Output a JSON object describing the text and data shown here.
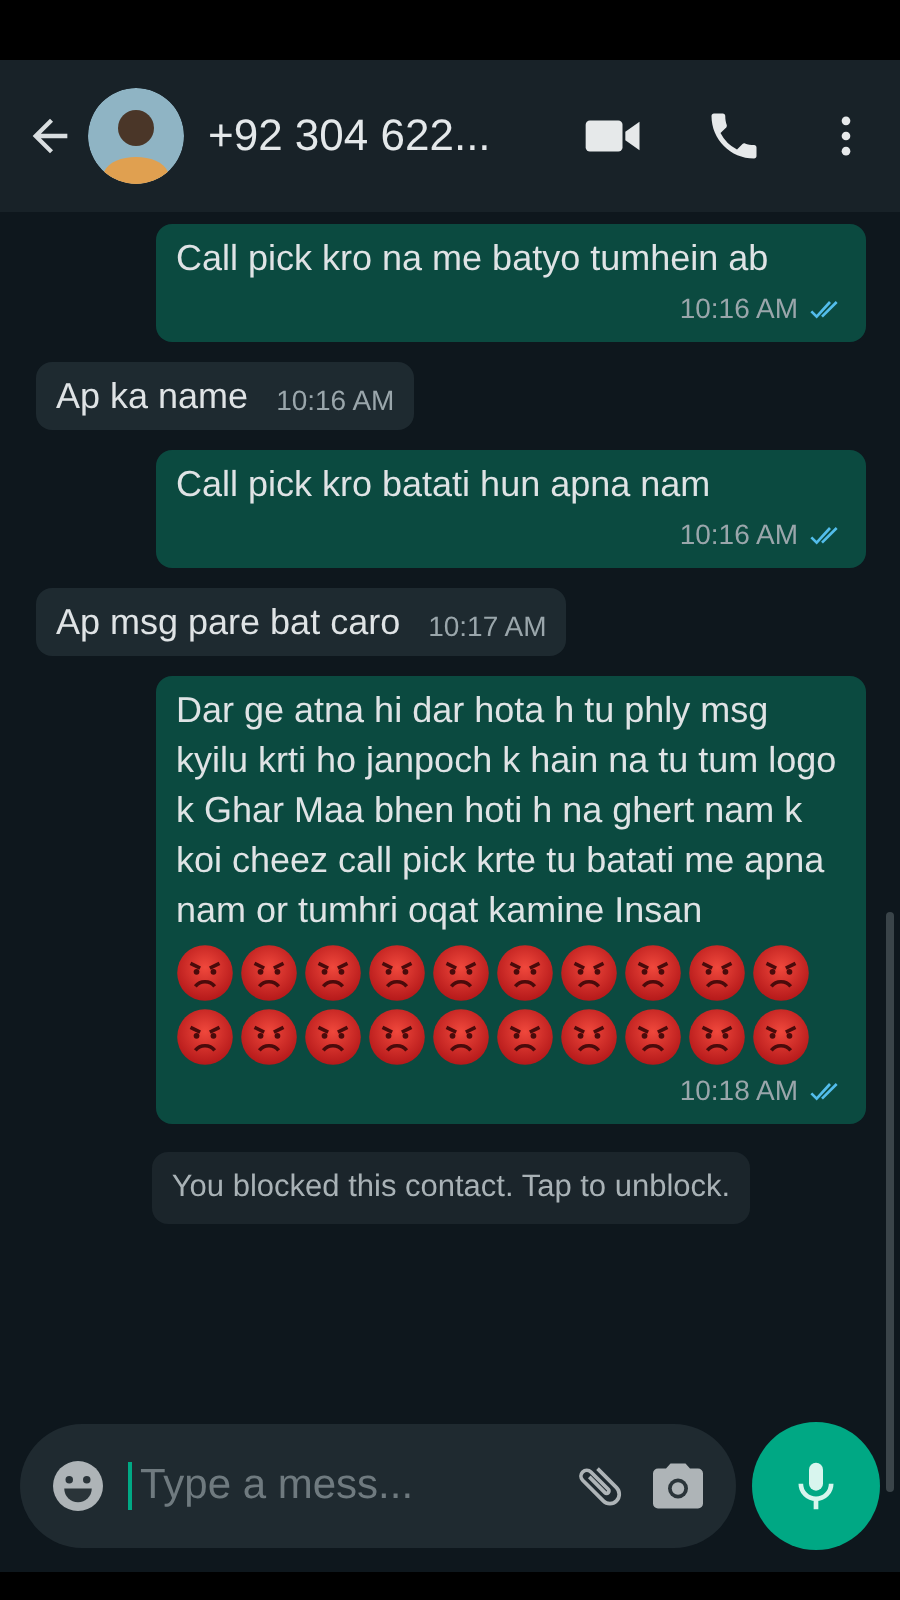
{
  "header": {
    "contact": "+92 304 622..."
  },
  "messages": [
    {
      "kind": "outgoing",
      "text": "Call pick kro na me batyo tumhein ab",
      "time": "10:16 AM",
      "read": true
    },
    {
      "kind": "incoming",
      "text": "Ap ka name",
      "time": "10:16 AM"
    },
    {
      "kind": "outgoing",
      "text": "Call pick kro batati hun apna nam",
      "time": "10:16 AM",
      "read": true
    },
    {
      "kind": "incoming",
      "text": "Ap msg pare bat caro",
      "time": "10:17 AM"
    },
    {
      "kind": "outgoing",
      "text": "Dar ge atna hi dar hota h tu phly msg kyilu krti ho janpoch k hain na tu tum logo k Ghar Maa bhen hoti h na ghert nam k koi cheez call pick krte tu batati me apna nam or tumhri oqat kamine Insan",
      "emoji": [
        {
          "kind": "angry"
        },
        {
          "kind": "angry"
        },
        {
          "kind": "angry"
        },
        {
          "kind": "angry"
        },
        {
          "kind": "angry"
        },
        {
          "kind": "angry"
        },
        {
          "kind": "angry"
        },
        {
          "kind": "angry"
        },
        {
          "kind": "angry"
        },
        {
          "kind": "angry"
        },
        {
          "kind": "angry"
        },
        {
          "kind": "angry"
        },
        {
          "kind": "angry"
        },
        {
          "kind": "angry"
        },
        {
          "kind": "angry"
        },
        {
          "kind": "angry"
        },
        {
          "kind": "angry"
        },
        {
          "kind": "angry"
        },
        {
          "kind": "angry"
        },
        {
          "kind": "angry"
        }
      ],
      "time": "10:18 AM",
      "read": true
    }
  ],
  "system_notice": "You blocked this contact. Tap to unblock.",
  "composer": {
    "placeholder": "Type a mess..."
  }
}
